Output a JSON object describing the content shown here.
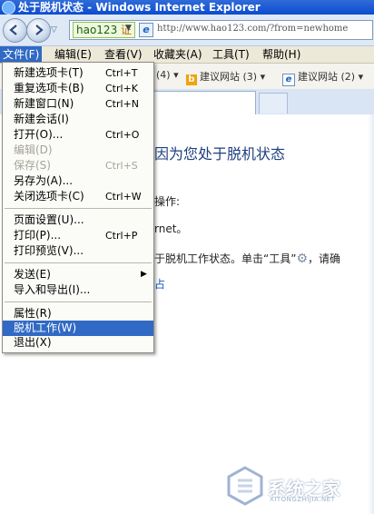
{
  "window": {
    "title": "处于脱机状态 - Windows Internet Explorer"
  },
  "address_bar": {
    "site_tag": "hao123",
    "site_tag_badge": "证",
    "url": "http://www.hao123.com/?from=newhome"
  },
  "menubar": [
    {
      "label": "文件(F)",
      "active": true
    },
    {
      "label": "编辑(E)"
    },
    {
      "label": "查看(V)"
    },
    {
      "label": "收藏夹(A)"
    },
    {
      "label": "工具(T)"
    },
    {
      "label": "帮助(H)"
    }
  ],
  "favorites": [
    {
      "label": "(4)",
      "icon": "none"
    },
    {
      "label": "建议网站 (3)",
      "icon": "bing-icon"
    },
    {
      "label": "建议网站 (2)",
      "icon": "ie-icon"
    }
  ],
  "file_menu": [
    {
      "label": "新建选项卡(T)",
      "shortcut": "Ctrl+T"
    },
    {
      "label": "重复选项卡(B)",
      "shortcut": "Ctrl+K"
    },
    {
      "label": "新建窗口(N)",
      "shortcut": "Ctrl+N"
    },
    {
      "label": "新建会话(I)",
      "shortcut": ""
    },
    {
      "label": "打开(O)...",
      "shortcut": "Ctrl+O"
    },
    {
      "label": "编辑(D)",
      "shortcut": "",
      "disabled": true
    },
    {
      "label": "保存(S)",
      "shortcut": "Ctrl+S",
      "disabled": true
    },
    {
      "label": "另存为(A)...",
      "shortcut": ""
    },
    {
      "label": "关闭选项卡(C)",
      "shortcut": "Ctrl+W"
    },
    {
      "label": "页面设置(U)...",
      "shortcut": ""
    },
    {
      "label": "打印(P)...",
      "shortcut": "Ctrl+P"
    },
    {
      "label": "打印预览(V)...",
      "shortcut": ""
    },
    {
      "label": "发送(E)",
      "shortcut": "",
      "submenu": true
    },
    {
      "label": "导入和导出(I)...",
      "shortcut": ""
    },
    {
      "label": "属性(R)",
      "shortcut": ""
    },
    {
      "label": "脱机工作(W)",
      "shortcut": "",
      "highlighted": true
    },
    {
      "label": "退出(X)",
      "shortcut": ""
    }
  ],
  "page": {
    "heading": "因为您处于脱机状态",
    "line1": "操作:",
    "line2": "rnet。",
    "line3_a": "于脱机工作状态。单击“工具”",
    "line3_b": "，请确",
    "link_fragment": "占"
  },
  "watermark": {
    "text": "系统之家",
    "sub": "XITONGZHIJIA.NET"
  },
  "colors": {
    "highlight": "#316ac5",
    "title_bar": "#1155cc",
    "menu_bg": "#fbfbf8"
  }
}
